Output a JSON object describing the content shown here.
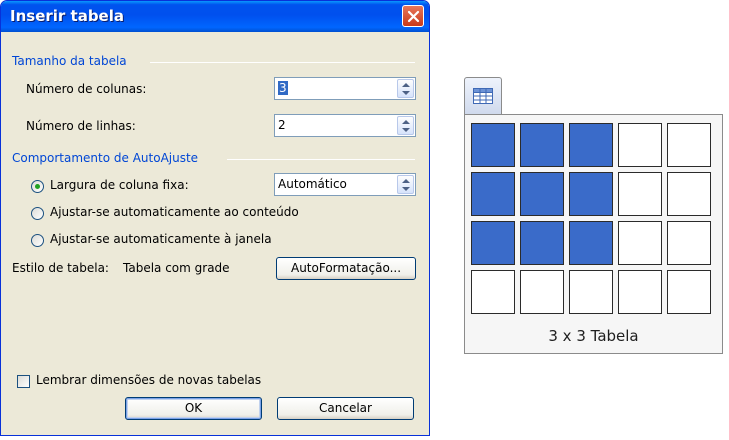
{
  "dialog": {
    "title": "Inserir tabela",
    "size_group": "Tamanho da tabela",
    "columns_label": "Número de colunas:",
    "columns_value": "3",
    "rows_label": "Número de linhas:",
    "rows_value": "2",
    "autofit_group": "Comportamento de AutoAjuste",
    "fixed_width_label": "Largura de coluna fixa:",
    "fixed_width_value": "Automático",
    "autofit_content_label": "Ajustar-se automaticamente ao conteúdo",
    "autofit_window_label": "Ajustar-se automaticamente à janela",
    "table_style_label": "Estilo de tabela:",
    "table_style_value": "Tabela com grade",
    "autoformat_button": "AutoFormatação...",
    "remember_label": "Lembrar dimensões de novas tabelas",
    "ok_button": "OK",
    "cancel_button": "Cancelar"
  },
  "picker": {
    "caption": "3 x 3 Tabela",
    "grid_columns": 5,
    "grid_rows": 4,
    "selected_columns": 3,
    "selected_rows": 3,
    "selected_color": "#3a6bc9"
  }
}
